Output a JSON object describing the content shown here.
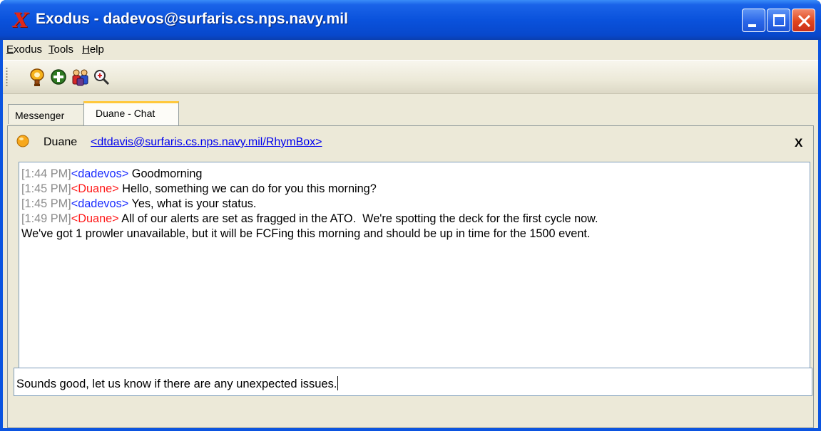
{
  "window": {
    "title": "Exodus - dadevos@surfaris.cs.nps.navy.mil",
    "app_icon": "exodus-x-icon"
  },
  "menu": [
    {
      "label": "Exodus",
      "accel": "E",
      "rest": "xodus"
    },
    {
      "label": "Tools",
      "accel": "T",
      "rest": "ools"
    },
    {
      "label": "Help",
      "accel": "H",
      "rest": "elp"
    }
  ],
  "toolbar": {
    "buttons": [
      "presence-icon",
      "add-contact-icon",
      "conference-icon",
      "search-icon"
    ]
  },
  "tabs": [
    {
      "label": "Messenger",
      "active": false
    },
    {
      "label": "Duane - Chat",
      "active": true
    }
  ],
  "chat": {
    "contact_name": "Duane",
    "contact_jid": "<dtdavis@surfaris.cs.nps.navy.mil/RhymBox>",
    "close_label": "X",
    "messages": [
      {
        "time": "[1:44 PM]",
        "nick": "<dadevos>",
        "text": " Goodmorning",
        "self": true
      },
      {
        "time": "[1:45 PM]",
        "nick": "<Duane>",
        "text": " Hello, something we can do for you this morning?",
        "self": false
      },
      {
        "time": "[1:45 PM]",
        "nick": "<dadevos>",
        "text": " Yes, what is your status.",
        "self": true
      },
      {
        "time": "[1:49 PM]",
        "nick": "<Duane>",
        "text": " All of our alerts are set as fragged in the ATO.  We're spotting the deck for the first cycle now.",
        "self": false
      }
    ],
    "continuation": "We've got 1 prowler unavailable, but it will be FCFing this morning and should be up in time for the 1500 event.",
    "compose_text": "Sounds good, let us know if there are any unexpected issues."
  },
  "colors": {
    "titlebar": "#0a52dc",
    "timestamp": "#8c8c8c",
    "self_nick": "#1a2cff",
    "peer_nick": "#ff1a1a",
    "link": "#0000ee"
  }
}
